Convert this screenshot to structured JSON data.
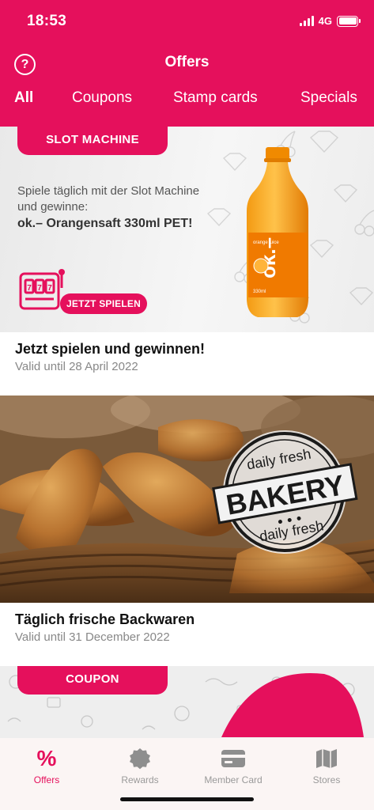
{
  "status": {
    "time": "18:53",
    "network": "4G"
  },
  "header": {
    "title": "Offers",
    "help_icon": "?"
  },
  "tabs": [
    {
      "label": "All",
      "active": true
    },
    {
      "label": "Coupons",
      "active": false
    },
    {
      "label": "Stamp cards",
      "active": false
    },
    {
      "label": "Specials",
      "active": false
    }
  ],
  "cards": [
    {
      "badge": "SLOT MACHINE",
      "banner_text": "Spiele täglich mit der Slot Machine und gewinne:",
      "banner_strong": "ok.– Orangensaft 330ml PET!",
      "button": "JETZT SPIELEN",
      "bottle_label": "ok.–",
      "bottle_small": "orange juice",
      "bottle_volume": "330ml",
      "title": "Jetzt spielen und gewinnen!",
      "valid": "Valid until 28 April 2022"
    },
    {
      "stamp_top": "daily fresh",
      "stamp_main": "BAKERY",
      "stamp_bottom": "daily fresh",
      "title": "Täglich frische Backwaren",
      "valid": "Valid until 31 December 2022"
    },
    {
      "badge": "COUPON"
    }
  ],
  "nav": [
    {
      "label": "Offers",
      "icon": "percent-icon",
      "active": true
    },
    {
      "label": "Rewards",
      "icon": "badge-icon",
      "active": false
    },
    {
      "label": "Member Card",
      "icon": "card-icon",
      "active": false
    },
    {
      "label": "Stores",
      "icon": "map-icon",
      "active": false
    }
  ],
  "colors": {
    "brand": "#e5105c",
    "muted": "#9a9a9a"
  }
}
